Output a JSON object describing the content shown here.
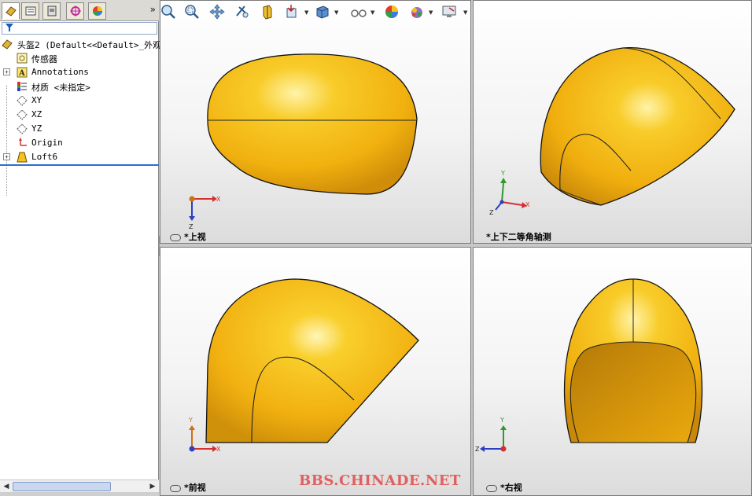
{
  "left_panel": {
    "tabs": [
      "feature-manager",
      "property-manager",
      "configuration-manager",
      "dimxpert-manager",
      "display-manager"
    ],
    "more_label": "»",
    "filter_icon": "filter-icon",
    "tree": {
      "root_label": "头盔2  (Default<<Default>_外观",
      "items": [
        {
          "label": "传感器",
          "icon": "sensor-icon",
          "expandable": false
        },
        {
          "label": "Annotations",
          "icon": "annotations-icon",
          "expandable": true
        },
        {
          "label": "材质 <未指定>",
          "icon": "material-icon",
          "expandable": false
        },
        {
          "label": "XY",
          "icon": "plane-icon",
          "expandable": false
        },
        {
          "label": "XZ",
          "icon": "plane-icon",
          "expandable": false
        },
        {
          "label": "YZ",
          "icon": "plane-icon",
          "expandable": false
        },
        {
          "label": "Origin",
          "icon": "origin-icon",
          "expandable": false
        },
        {
          "label": "Loft6",
          "icon": "loft-icon",
          "expandable": true
        }
      ]
    }
  },
  "toolbar": {
    "buttons": [
      "zoom-to-fit-icon",
      "zoom-to-area-icon",
      "pan-icon",
      "rotate-icon",
      "section-view-icon",
      "view-orientation-icon",
      "display-style-icon",
      "hide-show-items-icon",
      "edit-appearance-icon",
      "apply-scene-icon",
      "view-settings-icon"
    ]
  },
  "viewports": {
    "top": {
      "label": "*上视",
      "axes": [
        "X",
        "Z"
      ]
    },
    "isometric": {
      "label": "*上下二等角轴测",
      "axes": [
        "Y",
        "X",
        "Z"
      ]
    },
    "front": {
      "label": "*前视",
      "axes": [
        "Y",
        "X"
      ]
    },
    "right": {
      "label": "*右视",
      "axes": [
        "Y",
        "Z"
      ]
    }
  },
  "watermark": "BBS.CHINADE.NET",
  "colors": {
    "part_yellow": "#f6c21c",
    "part_dark": "#d4900a",
    "x_axis": "#d43030",
    "y_axis": "#2e9a2e",
    "z_axis": "#2a3fc4"
  }
}
